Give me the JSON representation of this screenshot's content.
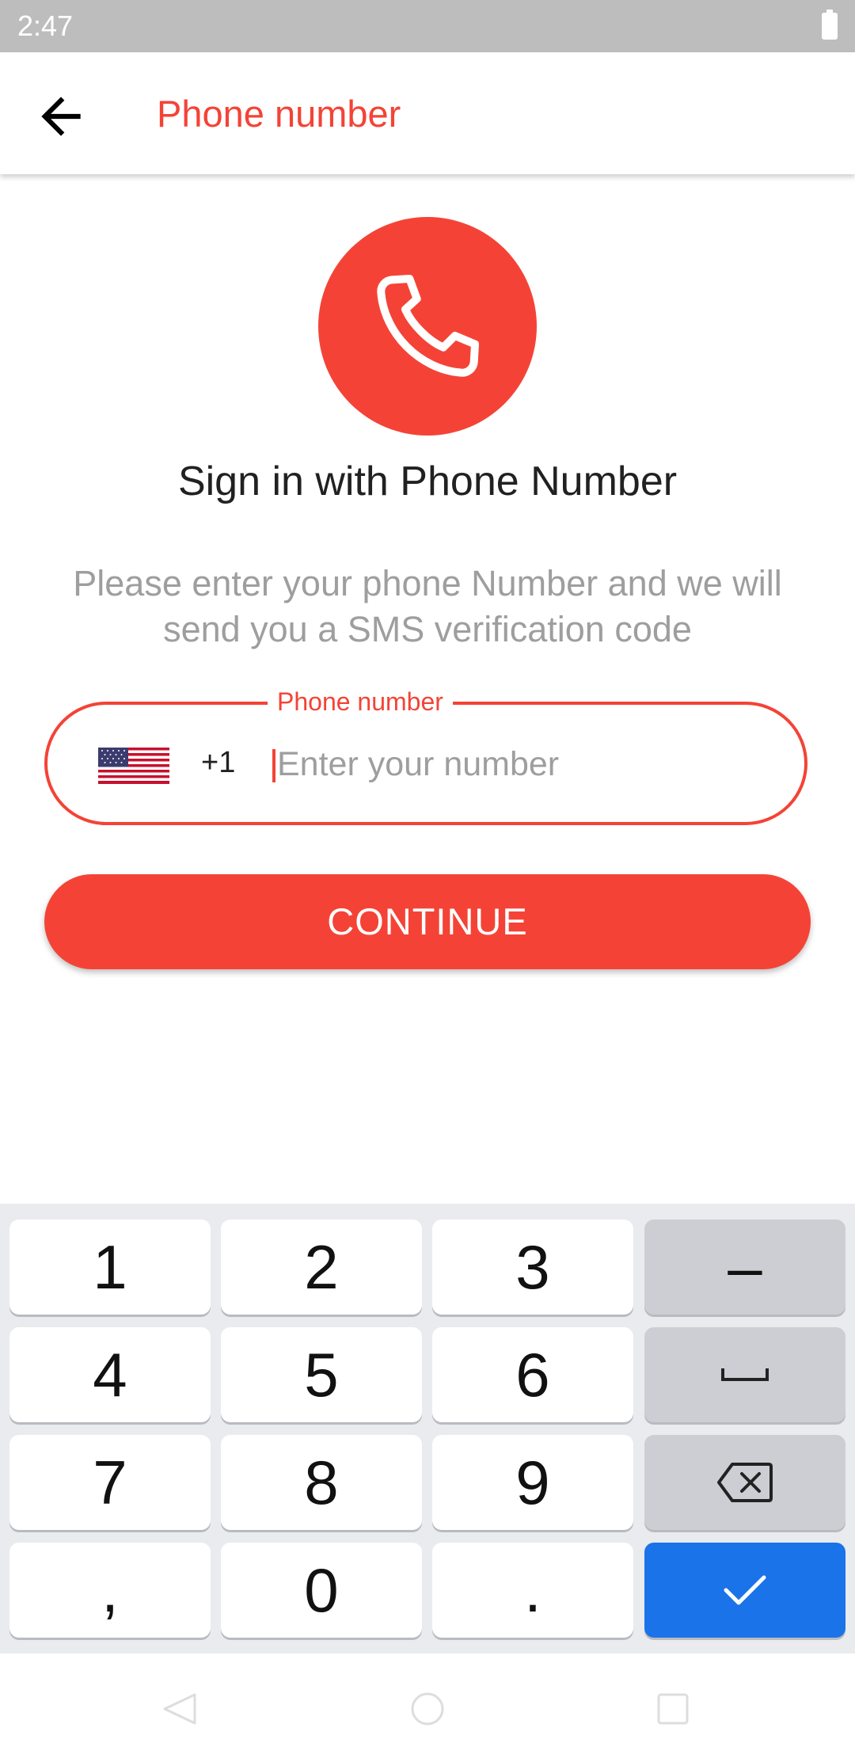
{
  "status_bar": {
    "time": "2:47",
    "battery_icon": "battery-full-icon"
  },
  "app_bar": {
    "title": "Phone number",
    "back_icon": "arrow-back-icon"
  },
  "content": {
    "hero_icon": "phone-icon",
    "heading": "Sign in with Phone Number",
    "subtext": "Please enter your phone Number and we will send you a SMS verification code",
    "phone_field": {
      "label": "Phone number",
      "flag_icon": "us-flag-icon",
      "dial_code": "+1",
      "placeholder": "Enter your number",
      "value": ""
    },
    "continue_label": "CONTINUE"
  },
  "keyboard": {
    "digits": [
      "1",
      "2",
      "3",
      "4",
      "5",
      "6",
      "7",
      "8",
      "9",
      "0"
    ],
    "comma": ",",
    "period": ".",
    "dash": "–",
    "space_icon": "space-icon",
    "backspace_icon": "backspace-icon",
    "enter_icon": "check-icon"
  },
  "nav_bar": {
    "back_icon": "nav-back-icon",
    "home_icon": "nav-home-icon",
    "recents_icon": "nav-recents-icon"
  },
  "colors": {
    "accent": "#f44336",
    "keyboard_enter": "#1a73e8",
    "status_bar": "#bdbdbd"
  }
}
